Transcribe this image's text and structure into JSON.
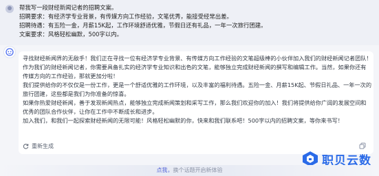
{
  "user_message": {
    "lines": [
      "帮我写一段财经新闻记者的招聘文案。",
      "招聘要求：有经济学专业背景，有传媒方向工作经验，文笔优秀，能接受经常出差。",
      "招聘待遇：有五险一金，月薪15K起，工作环境舒适优雅，节假日还有礼品，一年一次旅行团建。",
      "文案要求：风格轻松幽默，500字以内。"
    ]
  },
  "assistant_message": {
    "paragraphs": [
      "寻找财经新闻界的无敌手！我们正在寻找一位有经济学专业背景、有传媒方向工作经验的文笔超级棒的小伙伴加入我们的财经新闻记者团队！",
      "作为我们的财经新闻记者，你需要具备扎实的经济学专业知识和出色的文笔，能够独立完成财经新闻的撰写和编辑工作。当然，如果你还有",
      "传媒方向的工作经验，那就更加分啦！",
      "我们提供给你的不仅仅是一份工作，更是一个舒适优雅的工作环境，以及丰富的福利待遇。五险一金、月薪15K起、节假日礼品、一年一次的",
      "旅行团建，这些都是我们为你准备的惊喜。",
      "如果你热爱财经新闻，善于发现新闻热点，能够独立完成新闻策划和采写工作，那么我们欢迎你的加入！我们将提供给你广阔的发展空间和",
      "优秀的团队合作伙伴，让你在工作中不断成长和进步。",
      "加入我们，和我们一起探索财经新闻的无限可能！风格轻松幽默的你，快来和我们联系吧！500字以内的招聘文案，等你来书写！"
    ],
    "regenerate_label": "重新生成"
  },
  "footer": {
    "hint_prefix": "点我，",
    "hint_text": "换个话题开启新体验"
  },
  "watermark": {
    "text": "职贝云数"
  },
  "colors": {
    "accent": "#5868d8",
    "watermark": "#2b6be8"
  }
}
